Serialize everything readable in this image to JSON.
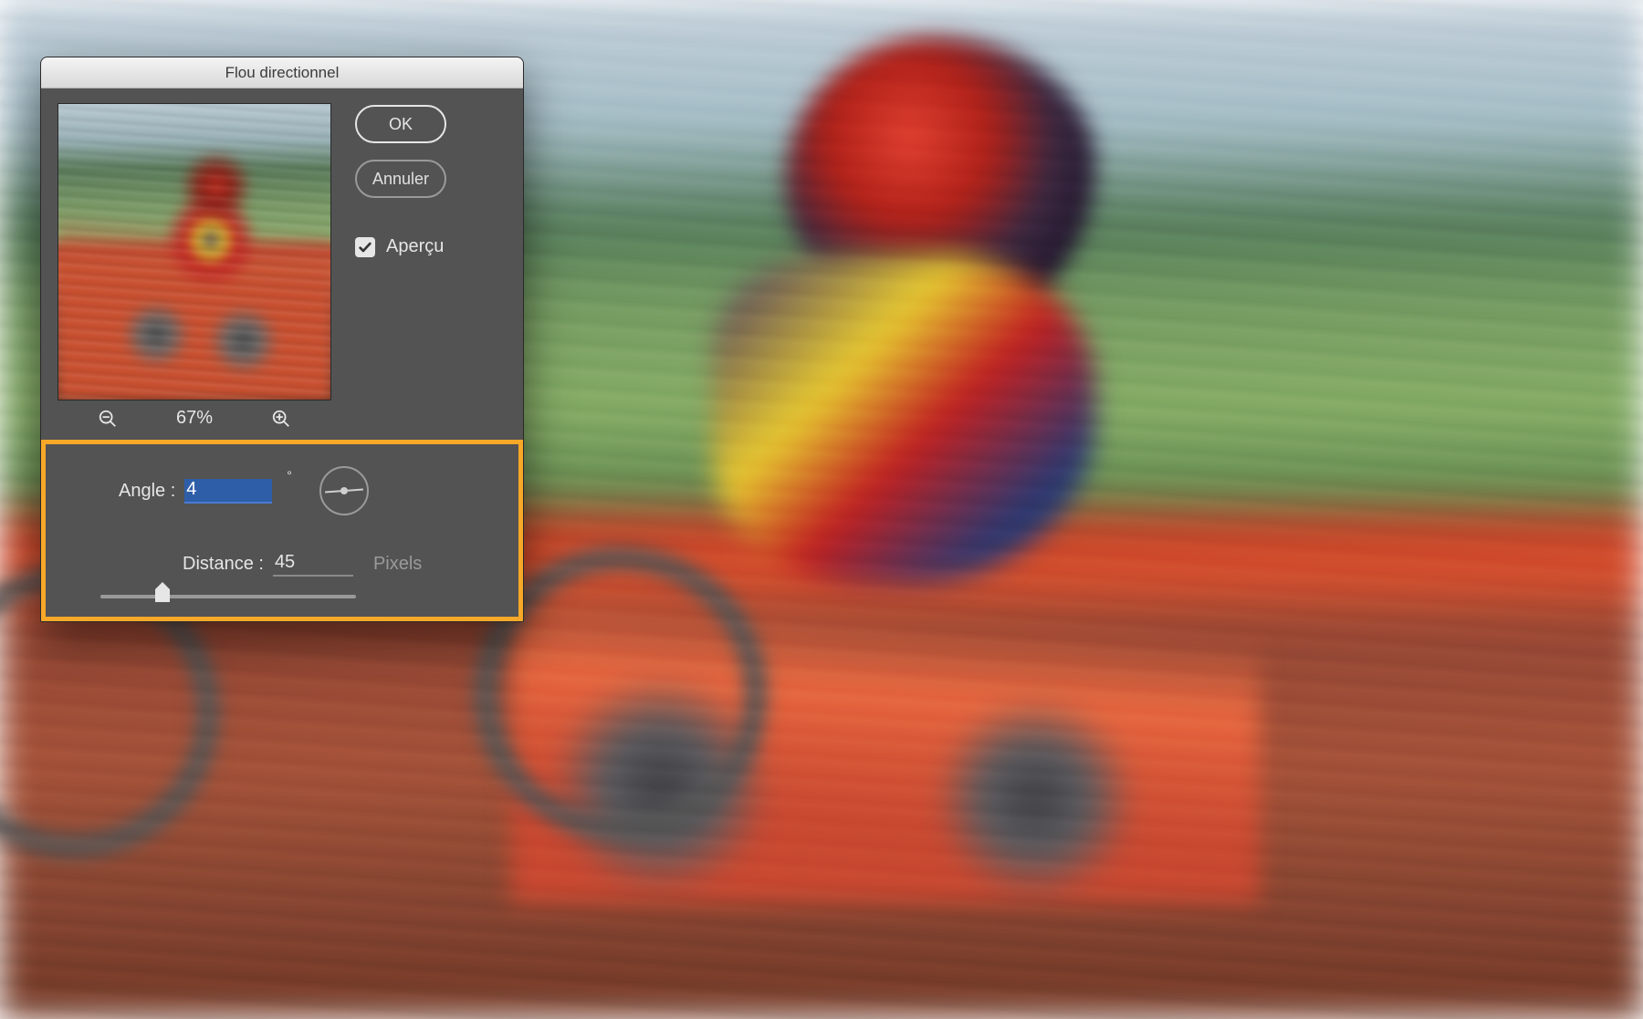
{
  "dialog": {
    "title": "Flou directionnel",
    "ok_label": "OK",
    "cancel_label": "Annuler",
    "preview_checkbox_label": "Aperçu",
    "preview_checked": true,
    "zoom_percent": "67%",
    "angle": {
      "label": "Angle :",
      "value": "4",
      "unit": "°"
    },
    "distance": {
      "label": "Distance :",
      "value": "45",
      "unit": "Pixels"
    }
  }
}
